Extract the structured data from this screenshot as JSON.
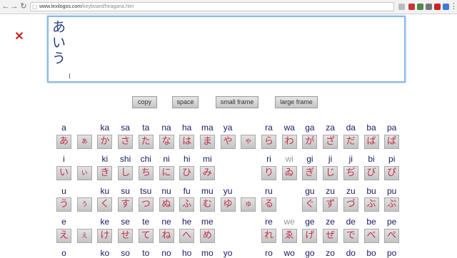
{
  "browser": {
    "url_domain": "www.lexilogos.com",
    "url_path": "/keyboard/hiragana.htm"
  },
  "editor": {
    "content": "あ\nい\nう",
    "caret_glyph": "I"
  },
  "clear_icon": "✕",
  "buttons": [
    {
      "label": "copy"
    },
    {
      "label": "space"
    },
    {
      "label": "small frame"
    },
    {
      "label": "large frame"
    }
  ],
  "kana_rows": [
    {
      "romaji": [
        {
          "col": 0,
          "text": "a"
        },
        {
          "col": 2,
          "text": "ka"
        },
        {
          "col": 3,
          "text": "sa"
        },
        {
          "col": 4,
          "text": "ta"
        },
        {
          "col": 5,
          "text": "na"
        },
        {
          "col": 6,
          "text": "ha"
        },
        {
          "col": 7,
          "text": "ma"
        },
        {
          "col": 8,
          "text": "ya"
        },
        {
          "col": 10,
          "text": "ra"
        },
        {
          "col": 11,
          "text": "wa"
        },
        {
          "col": 12,
          "text": "ga"
        },
        {
          "col": 13,
          "text": "za"
        },
        {
          "col": 14,
          "text": "da"
        },
        {
          "col": 15,
          "text": "ba"
        },
        {
          "col": 16,
          "text": "pa"
        }
      ],
      "keys": [
        {
          "col": 0,
          "text": "あ"
        },
        {
          "col": 1,
          "text": "ぁ"
        },
        {
          "col": 2,
          "text": "か"
        },
        {
          "col": 3,
          "text": "さ"
        },
        {
          "col": 4,
          "text": "た"
        },
        {
          "col": 5,
          "text": "な"
        },
        {
          "col": 6,
          "text": "は"
        },
        {
          "col": 7,
          "text": "ま"
        },
        {
          "col": 8,
          "text": "や"
        },
        {
          "col": 9,
          "text": "ゃ"
        },
        {
          "col": 10,
          "text": "ら"
        },
        {
          "col": 11,
          "text": "わ"
        },
        {
          "col": 12,
          "text": "が"
        },
        {
          "col": 13,
          "text": "ざ"
        },
        {
          "col": 14,
          "text": "だ"
        },
        {
          "col": 15,
          "text": "ば"
        },
        {
          "col": 16,
          "text": "ぱ"
        }
      ]
    },
    {
      "romaji": [
        {
          "col": 0,
          "text": "i"
        },
        {
          "col": 2,
          "text": "ki"
        },
        {
          "col": 3,
          "text": "shi"
        },
        {
          "col": 4,
          "text": "chi"
        },
        {
          "col": 5,
          "text": "ni"
        },
        {
          "col": 6,
          "text": "hi"
        },
        {
          "col": 7,
          "text": "mi"
        },
        {
          "col": 10,
          "text": "ri"
        },
        {
          "col": 11,
          "text": "wi",
          "muted": true
        },
        {
          "col": 12,
          "text": "gi"
        },
        {
          "col": 13,
          "text": "ji"
        },
        {
          "col": 14,
          "text": "ji"
        },
        {
          "col": 15,
          "text": "bi"
        },
        {
          "col": 16,
          "text": "pi"
        }
      ],
      "keys": [
        {
          "col": 0,
          "text": "い"
        },
        {
          "col": 1,
          "text": "ぃ"
        },
        {
          "col": 2,
          "text": "き"
        },
        {
          "col": 3,
          "text": "し"
        },
        {
          "col": 4,
          "text": "ち"
        },
        {
          "col": 5,
          "text": "に"
        },
        {
          "col": 6,
          "text": "ひ"
        },
        {
          "col": 7,
          "text": "み"
        },
        {
          "col": 10,
          "text": "り"
        },
        {
          "col": 11,
          "text": "ゐ"
        },
        {
          "col": 12,
          "text": "ぎ"
        },
        {
          "col": 13,
          "text": "じ"
        },
        {
          "col": 14,
          "text": "ぢ"
        },
        {
          "col": 15,
          "text": "び"
        },
        {
          "col": 16,
          "text": "ぴ"
        }
      ]
    },
    {
      "romaji": [
        {
          "col": 0,
          "text": "u"
        },
        {
          "col": 2,
          "text": "ku"
        },
        {
          "col": 3,
          "text": "su"
        },
        {
          "col": 4,
          "text": "tsu"
        },
        {
          "col": 5,
          "text": "nu"
        },
        {
          "col": 6,
          "text": "fu"
        },
        {
          "col": 7,
          "text": "mu"
        },
        {
          "col": 8,
          "text": "yu"
        },
        {
          "col": 10,
          "text": "ru"
        },
        {
          "col": 12,
          "text": "gu"
        },
        {
          "col": 13,
          "text": "zu"
        },
        {
          "col": 14,
          "text": "zu"
        },
        {
          "col": 15,
          "text": "bu"
        },
        {
          "col": 16,
          "text": "pu"
        }
      ],
      "keys": [
        {
          "col": 0,
          "text": "う"
        },
        {
          "col": 1,
          "text": "ぅ"
        },
        {
          "col": 2,
          "text": "く"
        },
        {
          "col": 3,
          "text": "す"
        },
        {
          "col": 4,
          "text": "つ"
        },
        {
          "col": 5,
          "text": "ぬ"
        },
        {
          "col": 6,
          "text": "ふ"
        },
        {
          "col": 7,
          "text": "む"
        },
        {
          "col": 8,
          "text": "ゆ"
        },
        {
          "col": 9,
          "text": "ゅ"
        },
        {
          "col": 10,
          "text": "る"
        },
        {
          "col": 12,
          "text": "ぐ"
        },
        {
          "col": 13,
          "text": "ず"
        },
        {
          "col": 14,
          "text": "づ"
        },
        {
          "col": 15,
          "text": "ぶ"
        },
        {
          "col": 16,
          "text": "ぷ"
        }
      ]
    },
    {
      "romaji": [
        {
          "col": 0,
          "text": "e"
        },
        {
          "col": 2,
          "text": "ke"
        },
        {
          "col": 3,
          "text": "se"
        },
        {
          "col": 4,
          "text": "te"
        },
        {
          "col": 5,
          "text": "ne"
        },
        {
          "col": 6,
          "text": "he"
        },
        {
          "col": 7,
          "text": "me"
        },
        {
          "col": 10,
          "text": "re"
        },
        {
          "col": 11,
          "text": "we",
          "muted": true
        },
        {
          "col": 12,
          "text": "ge"
        },
        {
          "col": 13,
          "text": "ze"
        },
        {
          "col": 14,
          "text": "de"
        },
        {
          "col": 15,
          "text": "be"
        },
        {
          "col": 16,
          "text": "pe"
        }
      ],
      "keys": [
        {
          "col": 0,
          "text": "え"
        },
        {
          "col": 1,
          "text": "ぇ"
        },
        {
          "col": 2,
          "text": "け"
        },
        {
          "col": 3,
          "text": "せ"
        },
        {
          "col": 4,
          "text": "て"
        },
        {
          "col": 5,
          "text": "ね"
        },
        {
          "col": 6,
          "text": "へ"
        },
        {
          "col": 7,
          "text": "め"
        },
        {
          "col": 10,
          "text": "れ"
        },
        {
          "col": 11,
          "text": "ゑ"
        },
        {
          "col": 12,
          "text": "げ"
        },
        {
          "col": 13,
          "text": "ぜ"
        },
        {
          "col": 14,
          "text": "で"
        },
        {
          "col": 15,
          "text": "べ"
        },
        {
          "col": 16,
          "text": "ぺ"
        }
      ]
    },
    {
      "romaji": [
        {
          "col": 0,
          "text": "o"
        },
        {
          "col": 2,
          "text": "ko"
        },
        {
          "col": 3,
          "text": "so"
        },
        {
          "col": 4,
          "text": "to"
        },
        {
          "col": 5,
          "text": "no"
        },
        {
          "col": 6,
          "text": "ho"
        },
        {
          "col": 7,
          "text": "mo"
        },
        {
          "col": 8,
          "text": "yo"
        },
        {
          "col": 10,
          "text": "ro"
        },
        {
          "col": 11,
          "text": "wo"
        },
        {
          "col": 12,
          "text": "go"
        },
        {
          "col": 13,
          "text": "zo"
        },
        {
          "col": 14,
          "text": "do"
        },
        {
          "col": 15,
          "text": "bo"
        },
        {
          "col": 16,
          "text": "po"
        }
      ],
      "keys": []
    }
  ]
}
